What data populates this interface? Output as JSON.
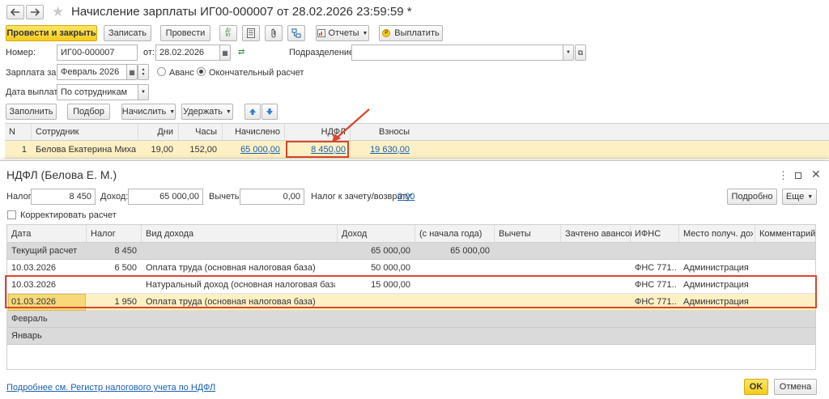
{
  "window": {
    "title": "Начисление зарплаты ИГ00-000007 от 28.02.2026 23:59:59 *"
  },
  "toolbar": {
    "post_close": "Провести и закрыть",
    "save": "Записать",
    "post": "Провести",
    "reports": "Отчеты",
    "pay": "Выплатить"
  },
  "form": {
    "number_label": "Номер:",
    "number_value": "ИГ00-000007",
    "from_label": "от:",
    "date_value": "28.02.2026",
    "division_label": "Подразделение:",
    "division_value": "",
    "salary_for_label": "Зарплата за:",
    "salary_for_value": "Февраль 2026",
    "advance_label": "Аванс",
    "final_label": "Окончательный расчет",
    "pay_date_label": "Дата выплаты:",
    "pay_date_value": "По сотрудникам"
  },
  "actions": {
    "fill": "Заполнить",
    "select": "Подбор",
    "accrue": "Начислить",
    "withhold": "Удержать"
  },
  "main_table": {
    "columns": [
      "N",
      "Сотрудник",
      "Дни",
      "Часы",
      "Начислено",
      "НДФЛ",
      "Взносы"
    ],
    "rows": [
      {
        "n": "1",
        "employee": "Белова Екатерина Михай...",
        "days": "19,00",
        "hours": "152,00",
        "accrued": "65 000,00",
        "ndfl": "8 450,00",
        "contrib": "19 630,00"
      }
    ]
  },
  "dialog": {
    "title": "НДФЛ (Белова Е. М.)",
    "tax_label": "Налог:",
    "tax_value": "8 450",
    "income_label": "Доход:",
    "income_value": "65 000,00",
    "deductions_label": "Вычеты:",
    "deductions_value": "0,00",
    "offset_label": "Налог к зачету/возврату:",
    "offset_value": "0.00",
    "detail_btn": "Подробно",
    "more_btn": "Еще",
    "correct_label": "Корректировать расчет",
    "columns": [
      "Дата",
      "Налог",
      "Вид дохода",
      "Доход",
      "(с начала года)",
      "Вычеты",
      "Зачтено авансов",
      "ИФНС",
      "Место получ. дох.",
      "Комментарий"
    ],
    "rows": [
      {
        "date": "Текущий расчет",
        "tax": "8 450",
        "kind": "",
        "income": "65 000,00",
        "ytd": "65 000,00",
        "ifns": "",
        "place": ""
      },
      {
        "date": "10.03.2026",
        "tax": "6 500",
        "kind": "Оплата труда (основная налоговая база)",
        "income": "50 000,00",
        "ytd": "",
        "ifns": "ФНС 771...",
        "place": "Администрация"
      },
      {
        "date": "10.03.2026",
        "tax": "",
        "kind": "Натуральный доход (основная налоговая база)",
        "income": "15 000,00",
        "ytd": "",
        "ifns": "ФНС 771...",
        "place": "Администрация"
      },
      {
        "date": "01.03.2026",
        "tax": "1 950",
        "kind": "Оплата труда (основная налоговая база)",
        "income": "",
        "ytd": "",
        "ifns": "ФНС 771...",
        "place": "Администрация"
      },
      {
        "date": "Февраль"
      },
      {
        "date": "Январь"
      }
    ],
    "footer_link": "Подробнее см. Регистр налогового учета по НДФЛ",
    "ok": "OK",
    "cancel": "Отмена"
  },
  "colors": {
    "accent_yellow": "#f5cb1c",
    "highlight_row": "#fdf0c4",
    "annotation_red": "#d9452f",
    "link_blue": "#1a5fb4"
  }
}
